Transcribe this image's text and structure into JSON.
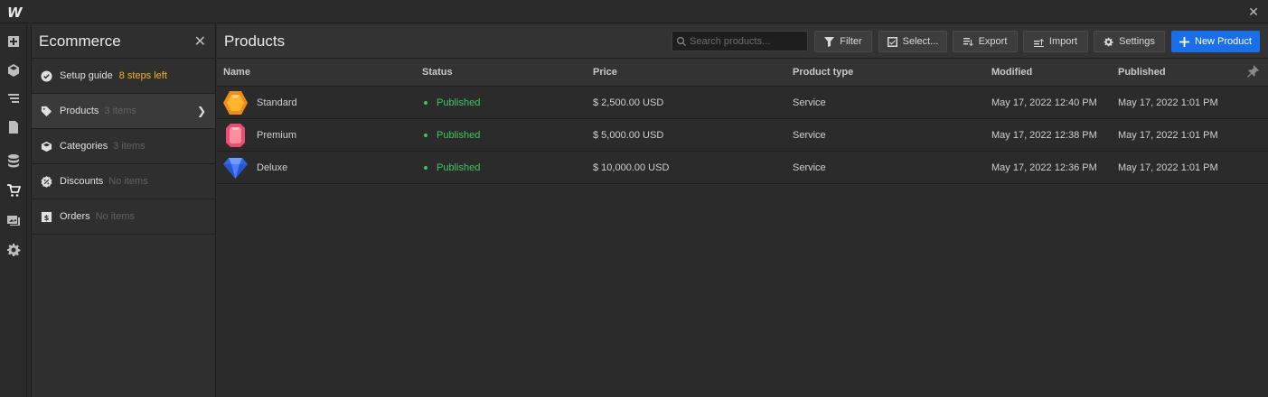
{
  "app": {
    "logo": "W"
  },
  "panel": {
    "title": "Ecommerce",
    "items": [
      {
        "label": "Setup guide",
        "sub": "8 steps left"
      },
      {
        "label": "Products",
        "sub": "3 items"
      },
      {
        "label": "Categories",
        "sub": "3 items"
      },
      {
        "label": "Discounts",
        "sub": "No items"
      },
      {
        "label": "Orders",
        "sub": "No items"
      }
    ]
  },
  "main": {
    "title": "Products",
    "search_placeholder": "Search products...",
    "buttons": {
      "filter": "Filter",
      "select": "Select...",
      "export": "Export",
      "import": "Import",
      "settings": "Settings",
      "new_product": "New Product"
    },
    "columns": [
      "Name",
      "Status",
      "Price",
      "Product type",
      "Modified",
      "Published"
    ],
    "rows": [
      {
        "name": "Standard",
        "status": "Published",
        "price": "$ 2,500.00 USD",
        "type": "Service",
        "modified": "May 17, 2022 12:40 PM",
        "published": "May 17, 2022 1:01 PM"
      },
      {
        "name": "Premium",
        "status": "Published",
        "price": "$ 5,000.00 USD",
        "type": "Service",
        "modified": "May 17, 2022 12:38 PM",
        "published": "May 17, 2022 1:01 PM"
      },
      {
        "name": "Deluxe",
        "status": "Published",
        "price": "$ 10,000.00 USD",
        "type": "Service",
        "modified": "May 17, 2022 12:36 PM",
        "published": "May 17, 2022 1:01 PM"
      }
    ]
  },
  "colors": {
    "accent": "#1a6ee8",
    "published": "#3fc566",
    "warning": "#f0b429"
  }
}
